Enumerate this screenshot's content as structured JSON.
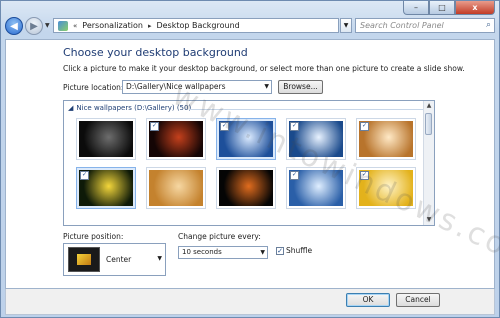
{
  "caption": {
    "min": "–",
    "max": "□",
    "close": "x"
  },
  "address_bar": {
    "chevron": "«",
    "crumbs": [
      "Personalization",
      "Desktop Background"
    ],
    "separator": "▸",
    "search_placeholder": "Search Control Panel"
  },
  "main": {
    "heading": "Choose your desktop background",
    "subtext": "Click a picture to make it your desktop background, or select more than one picture to create a slide show.",
    "picture_location_label": "Picture location:",
    "picture_location_value": "D:\\Gallery\\Nice wallpapers",
    "browse_label": "Browse..."
  },
  "gallery": {
    "group_header": "Nice wallpapers (D:\\Gallery) (50)",
    "thumbnails": [
      {
        "checked": false,
        "colors": [
          "#0b0b0b",
          "#6d6d6d"
        ],
        "selected": false
      },
      {
        "checked": true,
        "colors": [
          "#140505",
          "#c4401c"
        ],
        "selected": false
      },
      {
        "checked": true,
        "colors": [
          "#1d4f9a",
          "#dcebff"
        ],
        "selected": true
      },
      {
        "checked": true,
        "colors": [
          "#1a4a8c",
          "#e8f2ff"
        ],
        "selected": false
      },
      {
        "checked": true,
        "colors": [
          "#b8742c",
          "#ffe9c6"
        ],
        "selected": false
      },
      {
        "checked": true,
        "colors": [
          "#0e1a08",
          "#f3d63b"
        ],
        "selected": true
      },
      {
        "checked": false,
        "colors": [
          "#c4822e",
          "#f6d7a2"
        ],
        "selected": false
      },
      {
        "checked": false,
        "colors": [
          "#050505",
          "#e06c1e"
        ],
        "selected": false
      },
      {
        "checked": true,
        "colors": [
          "#2a5fa8",
          "#dfeeff"
        ],
        "selected": false
      },
      {
        "checked": true,
        "colors": [
          "#e3b21c",
          "#fff3c6"
        ],
        "selected": false
      }
    ]
  },
  "options": {
    "position_label": "Picture position:",
    "position_value": "Center",
    "change_label": "Change picture every:",
    "change_value": "10 seconds",
    "shuffle_label": "Shuffle",
    "shuffle_checked": true
  },
  "footer": {
    "ok_label": "OK",
    "cancel_label": "Cancel"
  },
  "watermark": "www.intowindows.com"
}
